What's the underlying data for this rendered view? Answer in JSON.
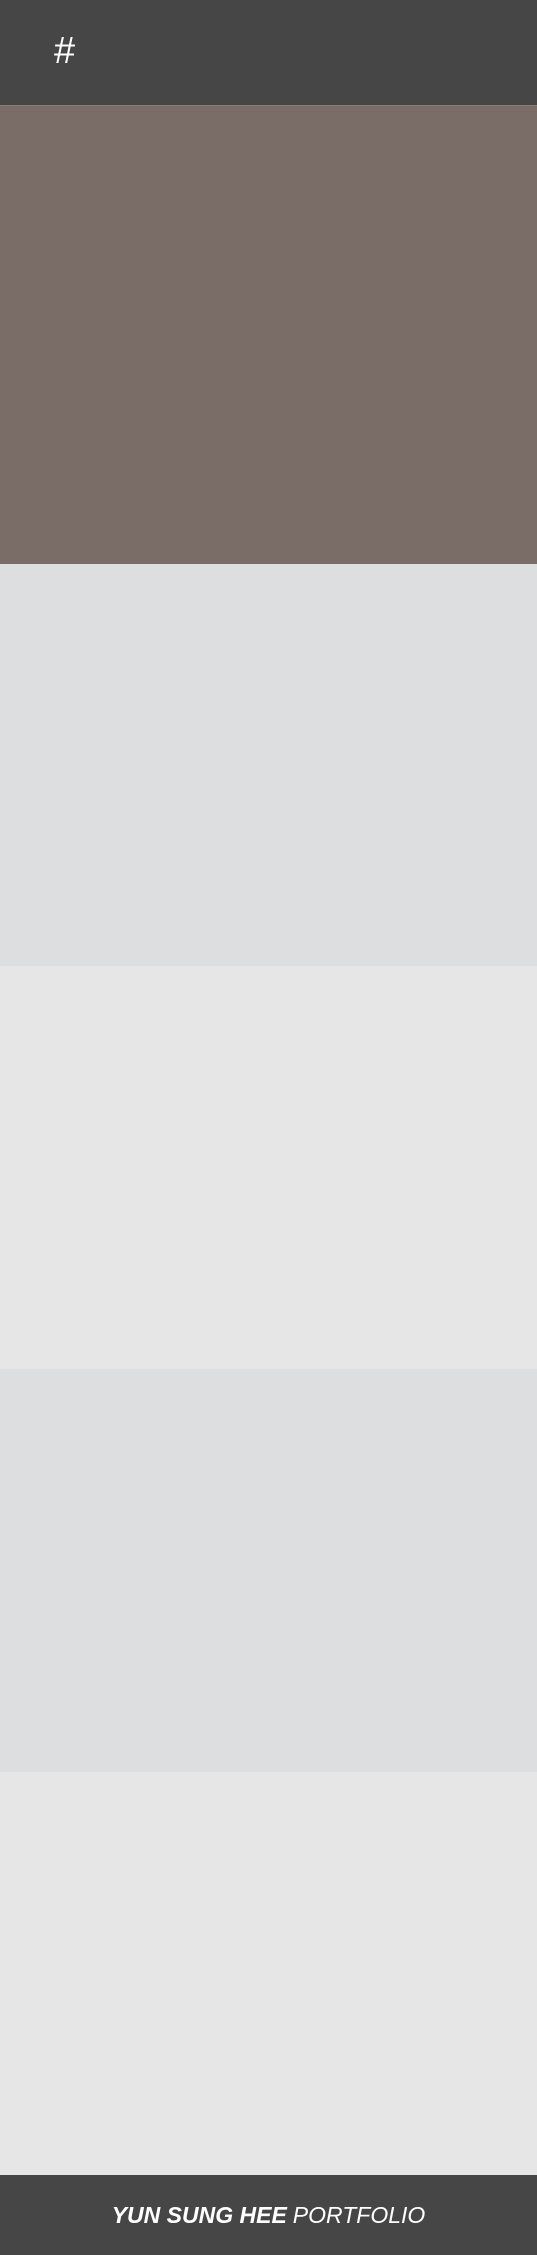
{
  "header": {
    "menu_symbol": "#"
  },
  "sections": [
    {
      "color": "#7a6c67"
    },
    {
      "color": "#dddedf"
    },
    {
      "color": "#e6e6e7"
    },
    {
      "color": "#dddedf"
    },
    {
      "color": "#e6e6e7"
    }
  ],
  "footer": {
    "name": "YUN SUNG HEE",
    "subtitle": "PORTFOLIO"
  },
  "colors": {
    "bar": "#464646",
    "accent": "#7a6c67"
  }
}
